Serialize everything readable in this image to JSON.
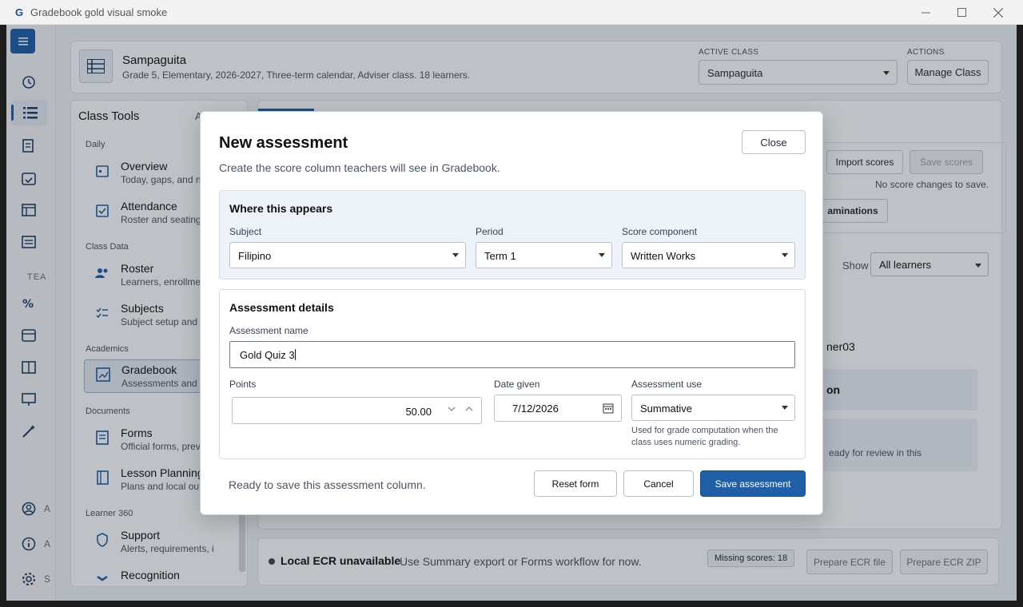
{
  "window": {
    "title": "Gradebook gold visual smoke",
    "app_icon": "G"
  },
  "header": {
    "class_name": "Sampaguita",
    "class_desc": "Grade 5, Elementary, 2026-2027, Three-term calendar, Adviser class. 18 learners.",
    "active_class_label": "ACTIVE CLASS",
    "active_class_value": "Sampaguita",
    "actions_label": "ACTIONS",
    "manage_class": "Manage Class"
  },
  "rail": {
    "teach_label": "TEA",
    "bottom_items": [
      "A",
      "A",
      "S"
    ]
  },
  "tools": {
    "title": "Class Tools",
    "title_extra": "A",
    "sections": {
      "daily": "Daily",
      "class_data": "Class Data",
      "academics": "Academics",
      "documents": "Documents",
      "learner360": "Learner 360"
    },
    "items": [
      {
        "title": "Overview",
        "desc": "Today, gaps, and ne"
      },
      {
        "title": "Attendance",
        "desc": "Roster and seating"
      },
      {
        "title": "Roster",
        "desc": "Learners, enrollmen"
      },
      {
        "title": "Subjects",
        "desc": "Subject setup and w"
      },
      {
        "title": "Gradebook",
        "desc": "Assessments and sc"
      },
      {
        "title": "Forms",
        "desc": "Official forms, previ"
      },
      {
        "title": "Lesson Planning",
        "desc": "Plans and local out"
      },
      {
        "title": "Support",
        "desc": "Alerts, requirements, i"
      },
      {
        "title": "Recognition",
        "desc": ""
      }
    ]
  },
  "main": {
    "import_scores": "Import scores",
    "save_scores": "Save scores",
    "no_changes": "No score changes to save.",
    "examinations": "aminations",
    "show_label": "Show",
    "show_value": "All learners",
    "learner_fragment": "ner03",
    "on_fragment": "on",
    "review_fragment": "eady for review in this"
  },
  "footer": {
    "title": "Local ECR unavailable",
    "desc": "Use Summary export or Forms workflow for now.",
    "badge": "Missing scores: 18",
    "prepare_file": "Prepare ECR file",
    "prepare_zip": "Prepare ECR ZIP"
  },
  "modal": {
    "title": "New assessment",
    "desc": "Create the score column teachers will see in Gradebook.",
    "close": "Close",
    "where": {
      "heading": "Where this appears",
      "subject_label": "Subject",
      "subject_value": "Filipino",
      "period_label": "Period",
      "period_value": "Term 1",
      "component_label": "Score component",
      "component_value": "Written Works"
    },
    "details": {
      "heading": "Assessment details",
      "name_label": "Assessment name",
      "name_value": "Gold Quiz 3",
      "points_label": "Points",
      "points_value": "50.00",
      "date_label": "Date given",
      "date_value": "7/12/2026",
      "use_label": "Assessment use",
      "use_value": "Summative",
      "use_help": "Used for grade computation when the class uses numeric grading."
    },
    "status": "Ready to save this assessment column.",
    "reset": "Reset form",
    "cancel": "Cancel",
    "save": "Save assessment"
  },
  "colors": {
    "accent": "#1f5fa8",
    "overlay": "rgba(20,32,48,0.28)"
  }
}
